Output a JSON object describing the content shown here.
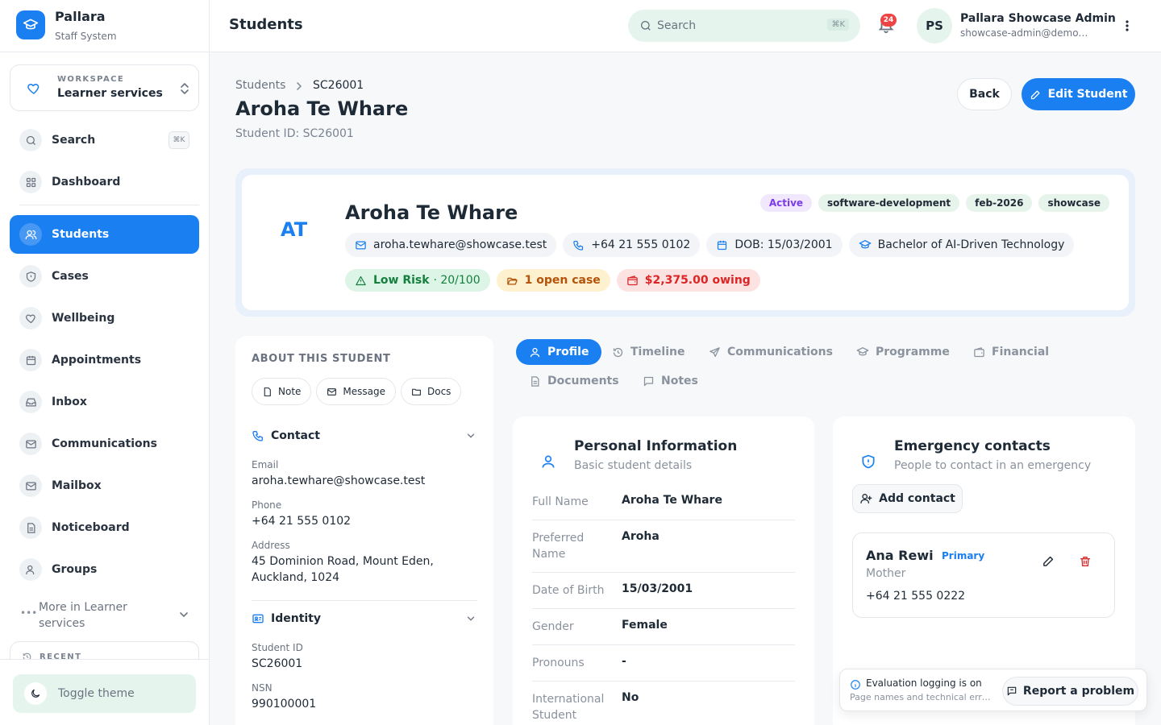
{
  "brand": {
    "name": "Pallara",
    "subtitle": "Staff System"
  },
  "workspace": {
    "label": "WORKSPACE",
    "name": "Learner services"
  },
  "sidebar": {
    "search_label": "Search",
    "search_kbd": "⌘K",
    "items": [
      {
        "label": "Dashboard",
        "icon": "grid-icon"
      },
      {
        "label": "Students",
        "icon": "users-icon",
        "active": true
      },
      {
        "label": "Cases",
        "icon": "shield-icon"
      },
      {
        "label": "Wellbeing",
        "icon": "heart-icon"
      },
      {
        "label": "Appointments",
        "icon": "calendar-icon"
      },
      {
        "label": "Inbox",
        "icon": "inbox-icon"
      },
      {
        "label": "Communications",
        "icon": "mail-icon"
      },
      {
        "label": "Mailbox",
        "icon": "mail-icon"
      },
      {
        "label": "Noticeboard",
        "icon": "document-icon"
      },
      {
        "label": "Groups",
        "icon": "users-icon"
      }
    ],
    "more_label": "More in Learner services",
    "recent_label": "RECENT",
    "toggle_theme_label": "Toggle theme"
  },
  "topbar": {
    "title": "Students",
    "search_placeholder": "Search",
    "search_kbd": "⌘K",
    "notification_count": "24",
    "user_initials": "PS",
    "user_name": "Pallara Showcase Admin",
    "user_email": "showcase-admin@demo.test"
  },
  "header": {
    "breadcrumb_root": "Students",
    "breadcrumb_current": "SC26001",
    "title": "Aroha Te Whare",
    "subtitle": "Student ID: SC26001",
    "back_label": "Back",
    "edit_label": "Edit Student"
  },
  "hero": {
    "initials": "AT",
    "name": "Aroha Te Whare",
    "tags": [
      {
        "label": "Active",
        "bg": "#f1e8fd",
        "color": "#7c3aed"
      },
      {
        "label": "software-development",
        "bg": "#e6f4ec",
        "color": "#1f2a37"
      },
      {
        "label": "feb-2026",
        "bg": "#e6f4ec",
        "color": "#1f2a37"
      },
      {
        "label": "showcase",
        "bg": "#e6f4ec",
        "color": "#1f2a37"
      }
    ],
    "email": "aroha.tewhare@showcase.test",
    "phone": "+64 21 555 0102",
    "dob": "DOB: 15/03/2001",
    "programme": "Bachelor of AI-Driven Technology",
    "risk_label": "Low Risk",
    "risk_score": "· 20/100",
    "open_cases": "1 open case",
    "owing": "$2,375.00 owing",
    "colors": {
      "risk_bg": "#dcf5e6",
      "risk_fg": "#15803d",
      "case_bg": "#fdf1d0",
      "case_fg": "#b45309",
      "owe_bg": "#fde2e2",
      "owe_fg": "#dc2626"
    }
  },
  "about": {
    "title": "ABOUT THIS STUDENT",
    "buttons": [
      "Note",
      "Message",
      "Docs"
    ],
    "contact": {
      "title": "Contact",
      "email_label": "Email",
      "email": "aroha.tewhare@showcase.test",
      "phone_label": "Phone",
      "phone": "+64 21 555 0102",
      "address_label": "Address",
      "address": "45 Dominion Road, Mount Eden, Auckland, 1024"
    },
    "identity": {
      "title": "Identity",
      "student_id_label": "Student ID",
      "student_id": "SC26001",
      "nsn_label": "NSN",
      "nsn": "990100001"
    }
  },
  "tabs": [
    "Profile",
    "Timeline",
    "Communications",
    "Programme",
    "Financial",
    "Documents",
    "Notes"
  ],
  "personal": {
    "title": "Personal Information",
    "subtitle": "Basic student details",
    "rows": [
      {
        "label": "Full Name",
        "value": "Aroha Te Whare"
      },
      {
        "label": "Preferred Name",
        "value": "Aroha"
      },
      {
        "label": "Date of Birth",
        "value": "15/03/2001"
      },
      {
        "label": "Gender",
        "value": "Female"
      },
      {
        "label": "Pronouns",
        "value": "-"
      },
      {
        "label": "International Student",
        "value": "No"
      }
    ]
  },
  "emergency": {
    "title": "Emergency contacts",
    "subtitle": "People to contact in an emergency",
    "add_label": "Add contact",
    "contact": {
      "name": "Ana Rewi",
      "badge": "Primary",
      "relationship": "Mother",
      "phone": "+64 21 555 0222"
    }
  },
  "toast": {
    "title": "Evaluation logging is on",
    "body": "Page names and technical errors are logged",
    "button": "Report a problem"
  }
}
